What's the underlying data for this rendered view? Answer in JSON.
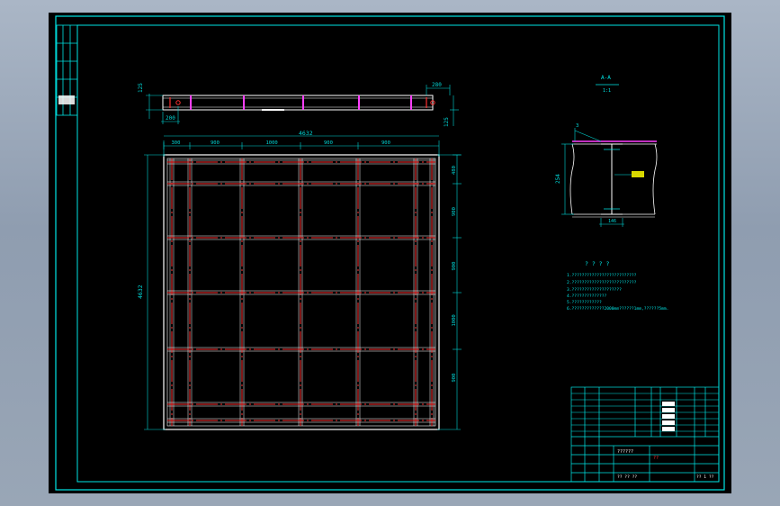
{
  "colors": {
    "viewport_bg": "#9aa7b8",
    "paper": "#000000",
    "frame": "#00e5e5",
    "dim": "#00d6d6",
    "beam": "#ff3030",
    "outline": "#ffffff",
    "accent": "#ff40ff",
    "title_text": "#ffffff"
  },
  "section_title": "A-A",
  "section_scale": "1:1",
  "plan": {
    "top_dims": [
      "300",
      "900",
      "1000",
      "900",
      "900"
    ],
    "overall_width": "4632",
    "overall_height": "4632",
    "right_dims": [
      "480",
      "900",
      "900",
      "1000",
      "900"
    ]
  },
  "elevation": {
    "left_dims": [
      "125",
      "200"
    ],
    "right_dims": [
      "280",
      "125"
    ]
  },
  "section": {
    "left_dim": "254",
    "bottom_dim": "146",
    "callout": "3"
  },
  "notes": {
    "heading": "? ? ? ?",
    "lines": [
      "1.??????????????????????????",
      "2.??????????????????????????",
      "3.????????????????????",
      "4.??????????????",
      "5.????????????",
      "6.?????????????2000mm??????1mm,??????5mm."
    ]
  },
  "title_block": {
    "name_label": "??????",
    "mark": "??",
    "bottom_label": "?? ?? ??",
    "sheet_no": "?? 1 ??"
  }
}
